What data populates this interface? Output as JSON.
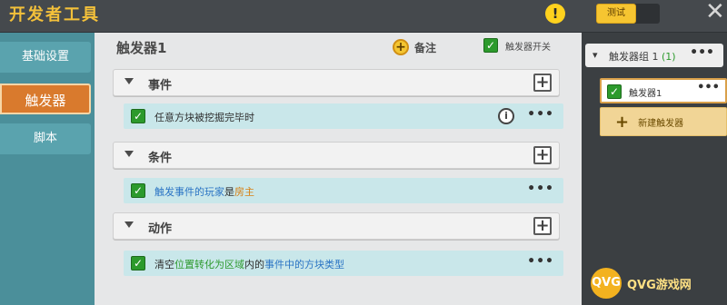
{
  "app": {
    "title": "开发者工具",
    "test_label": "测试",
    "close_glyph": "✕",
    "warn_glyph": "!"
  },
  "leftnav": {
    "items": [
      {
        "label": "基础设置"
      },
      {
        "label": "触发器"
      },
      {
        "label": "脚本"
      }
    ]
  },
  "main": {
    "title": "触发器1",
    "note_label": "备注",
    "note_icon": "+",
    "toggle_label": "触发器开关",
    "sections": [
      {
        "title": "事件",
        "items": [
          {
            "parts": [
              {
                "text": "任意方块被挖掘完毕时",
                "color": "default"
              }
            ],
            "has_info": true
          }
        ]
      },
      {
        "title": "条件",
        "items": [
          {
            "parts": [
              {
                "text": "触发事件的玩家",
                "color": "blue"
              },
              {
                "text": "是",
                "color": "default"
              },
              {
                "text": "房主",
                "color": "orange"
              }
            ],
            "has_info": false
          }
        ]
      },
      {
        "title": "动作",
        "items": [
          {
            "parts": [
              {
                "text": "清空",
                "color": "default"
              },
              {
                "text": "位置转化为区域",
                "color": "green"
              },
              {
                "text": "内的",
                "color": "default"
              },
              {
                "text": "事件中的方块类型",
                "color": "blue"
              }
            ],
            "has_info": false
          }
        ]
      }
    ],
    "more_glyph": "•••",
    "plus_glyph": "+",
    "check_glyph": "✓",
    "info_glyph": "i",
    "colors": {
      "blue": "#2a74c4",
      "orange": "#d77f13",
      "green": "#2e9a2e"
    }
  },
  "rightpanel": {
    "group_label": "触发器组 1",
    "group_count": "(1)",
    "chevron_glyph": "▾",
    "trigger_label": "触发器1",
    "new_trigger_label": "新建触发器",
    "new_trigger_plus": "+"
  },
  "watermark": {
    "logo_text": "QVG",
    "text": "QVG游戏网"
  }
}
